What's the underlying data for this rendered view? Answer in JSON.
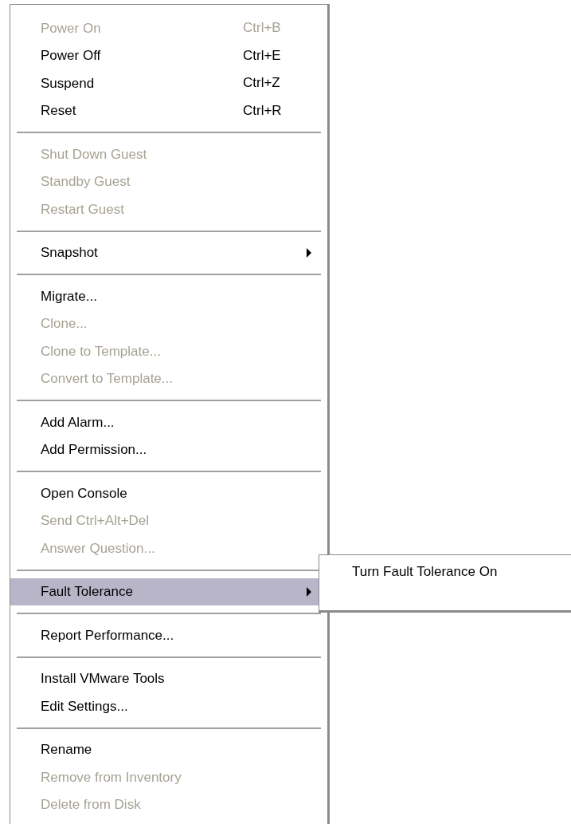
{
  "menu": {
    "groups": [
      {
        "items": [
          {
            "label": "Power On",
            "shortcut": "Ctrl+B",
            "disabled": true,
            "selected": false
          },
          {
            "label": "Power Off",
            "shortcut": "Ctrl+E",
            "disabled": false,
            "selected": false
          },
          {
            "label": "Suspend",
            "shortcut": "Ctrl+Z",
            "disabled": false,
            "selected": false
          },
          {
            "label": "Reset",
            "shortcut": "Ctrl+R",
            "disabled": false,
            "selected": false
          }
        ]
      },
      {
        "items": [
          {
            "label": "Shut Down Guest",
            "disabled": true,
            "selected": false
          },
          {
            "label": "Standby Guest",
            "disabled": true,
            "selected": false
          },
          {
            "label": "Restart Guest",
            "disabled": true,
            "selected": false
          }
        ]
      },
      {
        "items": [
          {
            "label": "Snapshot",
            "disabled": false,
            "selected": false,
            "has_submenu": true
          }
        ]
      },
      {
        "items": [
          {
            "label": "Migrate...",
            "disabled": false,
            "selected": false
          },
          {
            "label": "Clone...",
            "disabled": true,
            "selected": false
          },
          {
            "label": "Clone to Template...",
            "disabled": true,
            "selected": false
          },
          {
            "label": "Convert to Template...",
            "disabled": true,
            "selected": false
          }
        ]
      },
      {
        "items": [
          {
            "label": "Add Alarm...",
            "disabled": false,
            "selected": false
          },
          {
            "label": "Add Permission...",
            "disabled": false,
            "selected": false
          }
        ]
      },
      {
        "items": [
          {
            "label": "Open Console",
            "disabled": false,
            "selected": false
          },
          {
            "label": "Send Ctrl+Alt+Del",
            "disabled": true,
            "selected": false
          },
          {
            "label": "Answer Question...",
            "disabled": true,
            "selected": false
          }
        ]
      },
      {
        "items": [
          {
            "label": "Fault Tolerance",
            "disabled": false,
            "selected": true,
            "has_submenu": true,
            "submenu": [
              {
                "label": "Turn Fault Tolerance On",
                "disabled": false
              }
            ]
          }
        ]
      },
      {
        "items": [
          {
            "label": "Report Performance...",
            "disabled": false,
            "selected": false
          }
        ]
      },
      {
        "items": [
          {
            "label": "Install VMware Tools",
            "disabled": false,
            "selected": false
          },
          {
            "label": "Edit Settings...",
            "disabled": false,
            "selected": false
          }
        ]
      },
      {
        "items": [
          {
            "label": "Rename",
            "disabled": false,
            "selected": false
          },
          {
            "label": "Remove from Inventory",
            "disabled": true,
            "selected": false
          },
          {
            "label": "Delete from Disk",
            "disabled": true,
            "selected": false
          }
        ]
      }
    ]
  }
}
